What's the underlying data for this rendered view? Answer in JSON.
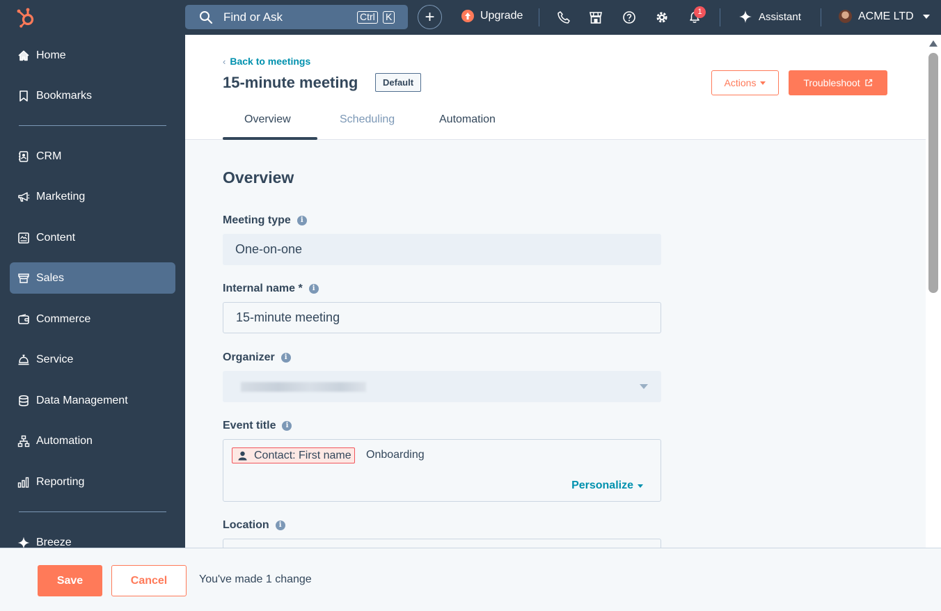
{
  "topbar": {
    "search_label": "Find or Ask",
    "shortcut_ctrl": "Ctrl",
    "shortcut_key": "K",
    "create_label": "+",
    "upgrade_label": "Upgrade",
    "notification_count": "1",
    "assistant_label": "Assistant",
    "account_name": "ACME LTD",
    "icons": [
      "search-icon",
      "phone-icon",
      "marketplace-icon",
      "help-icon",
      "settings-icon",
      "bell-icon",
      "sparkle-icon"
    ]
  },
  "sidebar": {
    "items": [
      {
        "label": "Home",
        "icon": "home-icon"
      },
      {
        "label": "Bookmarks",
        "icon": "bookmark-icon"
      },
      {
        "label": "CRM",
        "icon": "contacts-icon"
      },
      {
        "label": "Marketing",
        "icon": "megaphone-icon"
      },
      {
        "label": "Content",
        "icon": "content-icon"
      },
      {
        "label": "Sales",
        "icon": "sales-icon",
        "active": true
      },
      {
        "label": "Commerce",
        "icon": "wallet-icon"
      },
      {
        "label": "Service",
        "icon": "bell-service-icon"
      },
      {
        "label": "Data Management",
        "icon": "database-icon"
      },
      {
        "label": "Automation",
        "icon": "workflow-icon"
      },
      {
        "label": "Reporting",
        "icon": "bar-chart-icon"
      },
      {
        "label": "Breeze",
        "icon": "sparkle-icon"
      }
    ]
  },
  "header": {
    "back_label": "Back to meetings",
    "title": "15-minute meeting",
    "default_tag": "Default",
    "actions_label": "Actions",
    "troubleshoot_label": "Troubleshoot",
    "tabs": [
      {
        "label": "Overview",
        "active": true
      },
      {
        "label": "Scheduling",
        "active": false
      },
      {
        "label": "Automation",
        "active": false
      }
    ]
  },
  "overview": {
    "section_title": "Overview",
    "meeting_type_label": "Meeting type",
    "meeting_type_value": "One-on-one",
    "internal_name_label": "Internal name *",
    "internal_name_value": "15-minute meeting",
    "organizer_label": "Organizer",
    "event_title_label": "Event title",
    "event_title_token": "Contact: First name",
    "event_title_text": "Onboarding",
    "personalize_label": "Personalize",
    "location_label": "Location"
  },
  "footer": {
    "save_label": "Save",
    "cancel_label": "Cancel",
    "change_message": "You've made 1 change"
  },
  "colors": {
    "nav_bg": "#2d3e50",
    "nav_active": "#516f90",
    "accent": "#ff7a59",
    "link": "#0091ae",
    "badge": "#f2545b"
  }
}
